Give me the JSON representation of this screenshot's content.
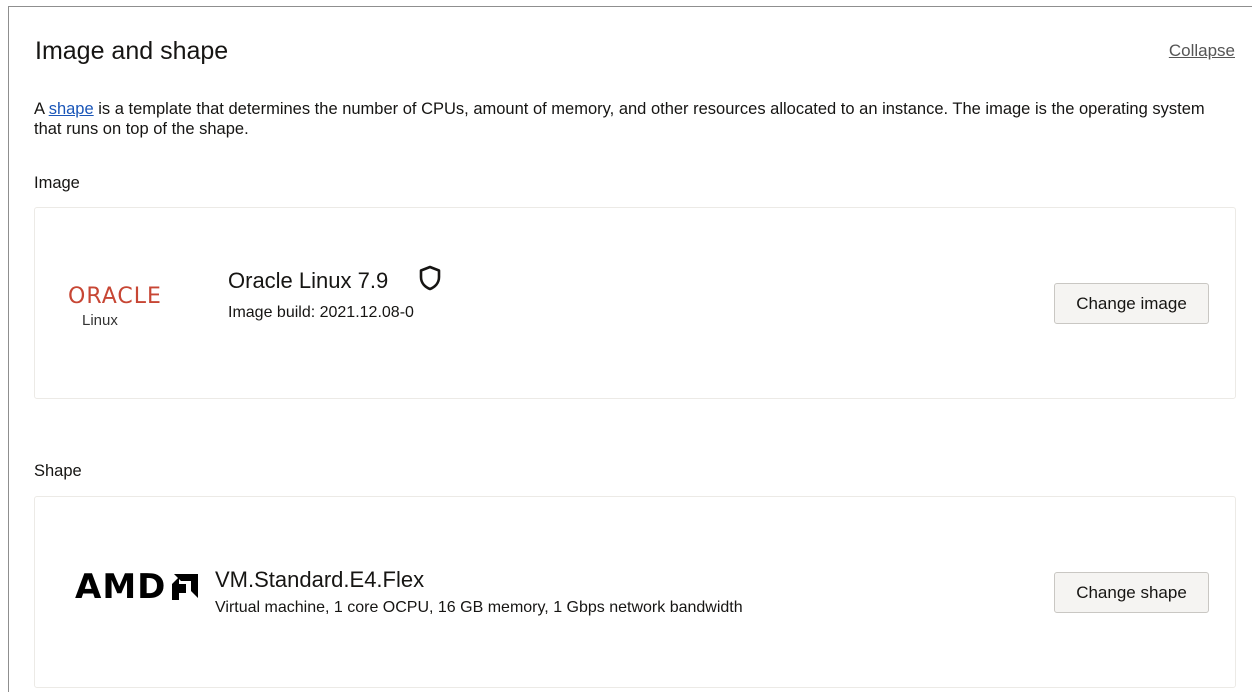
{
  "section": {
    "title": "Image and shape",
    "collapse_label": "Collapse",
    "description_prefix": "A ",
    "description_link": "shape",
    "description_suffix": " is a template that determines the number of CPUs, amount of memory, and other resources allocated to an instance. The image is the operating system that runs on top of the shape."
  },
  "image": {
    "label": "Image",
    "logo_word": "ORACLE",
    "logo_sub": "Linux",
    "name": "Oracle Linux 7.9",
    "build": "Image build: 2021.12.08-0",
    "icon": "shield-icon",
    "button_label": "Change image"
  },
  "shape": {
    "label": "Shape",
    "logo_word": "AMD",
    "name": "VM.Standard.E4.Flex",
    "details": "Virtual machine, 1 core OCPU, 16 GB memory, 1 Gbps network bandwidth",
    "button_label": "Change shape"
  },
  "colors": {
    "oracle_red": "#c74634",
    "link_blue": "#1a56b8"
  }
}
